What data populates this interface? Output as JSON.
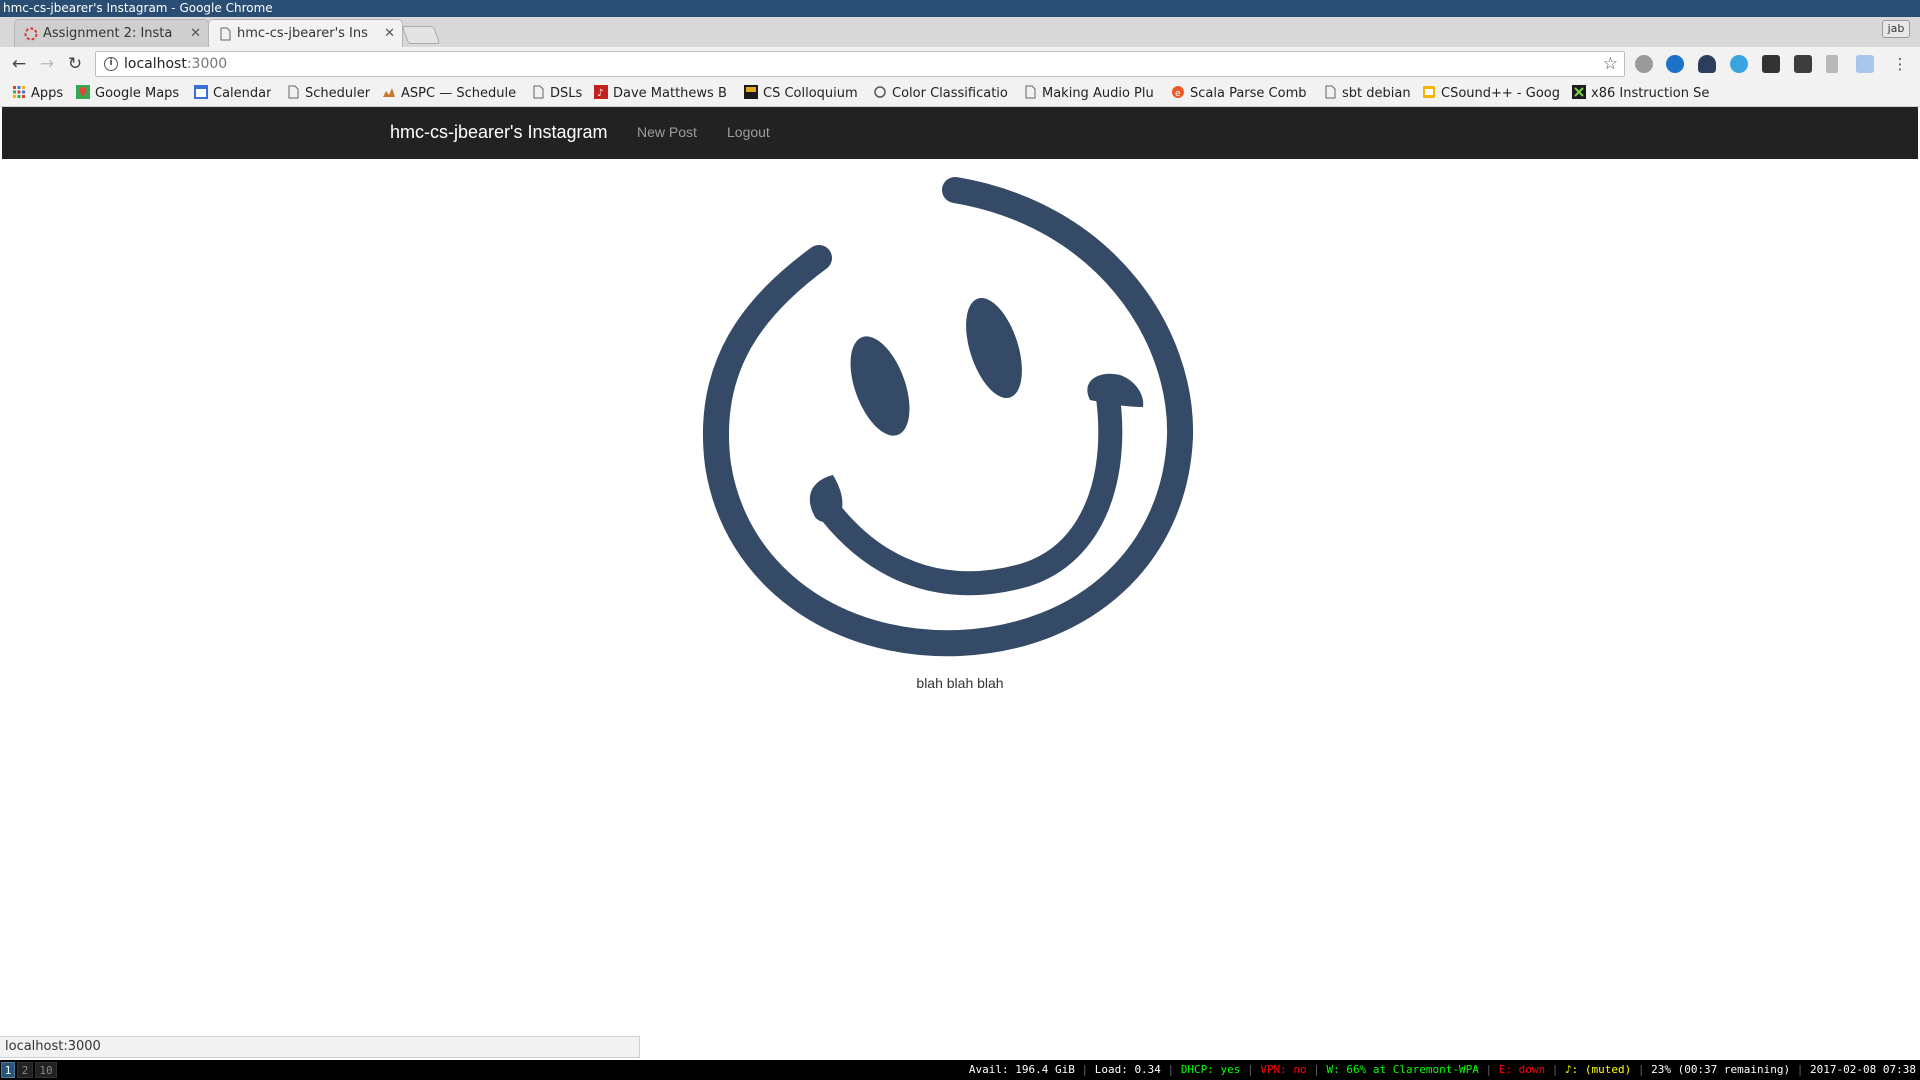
{
  "window": {
    "title": "hmc-cs-jbearer's Instagram - Google Chrome"
  },
  "tabs": [
    {
      "title": "Assignment 2: Insta",
      "active": false
    },
    {
      "title": "hmc-cs-jbearer's Ins",
      "active": true
    }
  ],
  "profile_label": "jab",
  "toolbar": {
    "url_host": "localhost",
    "url_port": ":3000"
  },
  "bookmarks": [
    {
      "label": "Apps",
      "icon": "apps-grid-icon"
    },
    {
      "label": "Google Maps",
      "icon": "maps-icon"
    },
    {
      "label": "Calendar",
      "icon": "calendar-icon"
    },
    {
      "label": "Scheduler",
      "icon": "page-icon"
    },
    {
      "label": "ASPC — Schedule",
      "icon": "aspc-icon"
    },
    {
      "label": "DSLs",
      "icon": "page-icon"
    },
    {
      "label": "Dave Matthews B",
      "icon": "music-icon"
    },
    {
      "label": "CS Colloquium",
      "icon": "hmc-cs-icon"
    },
    {
      "label": "Color Classificatio",
      "icon": "color-icon"
    },
    {
      "label": "Making Audio Plu",
      "icon": "page-icon"
    },
    {
      "label": "Scala Parse Comb",
      "icon": "scala-icon"
    },
    {
      "label": "sbt debian",
      "icon": "page-icon"
    },
    {
      "label": "CSound++ - Goog",
      "icon": "slides-icon"
    },
    {
      "label": "x86 Instruction Se",
      "icon": "x86-icon"
    }
  ],
  "site": {
    "brand": "hmc-cs-jbearer's Instagram",
    "nav": {
      "new_post": "New Post",
      "logout": "Logout"
    },
    "post": {
      "caption": "blah blah blah",
      "image_color": "#354a67"
    }
  },
  "statusbar": {
    "url": "localhost:3000"
  },
  "i3": {
    "workspaces": [
      "1",
      "2",
      "10"
    ],
    "focused_workspace": "1",
    "disk": "Avail: 196.4 GiB",
    "load": "Load: 0.34",
    "dhcp": "DHCP: yes",
    "vpn": "VPN: no",
    "wifi": "W:  66% at Claremont-WPA",
    "ethernet": "E: down",
    "volume": "♪: (muted)",
    "battery": "23% (00:37 remaining)",
    "clock": "2017-02-08 07:38"
  }
}
